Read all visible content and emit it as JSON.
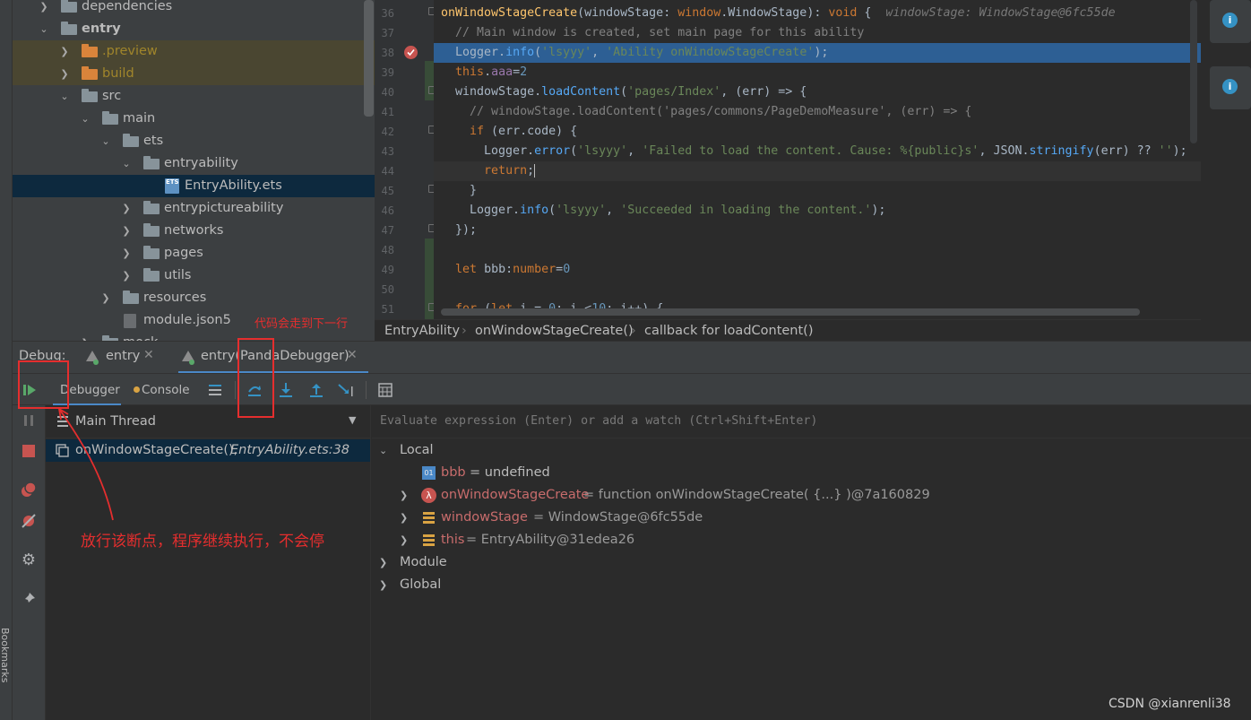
{
  "project_tree": {
    "items": [
      {
        "label": "dependencies"
      },
      {
        "label": "entry"
      },
      {
        "label": ".preview"
      },
      {
        "label": "build"
      },
      {
        "label": "src"
      },
      {
        "label": "main"
      },
      {
        "label": "ets"
      },
      {
        "label": "entryability"
      },
      {
        "label": "EntryAbility.ets",
        "icon_text": "ETS"
      },
      {
        "label": "entrypictureability"
      },
      {
        "label": "networks"
      },
      {
        "label": "pages"
      },
      {
        "label": "utils"
      },
      {
        "label": "resources"
      },
      {
        "label": "module.json5"
      },
      {
        "label": "mock"
      }
    ]
  },
  "editor": {
    "line_numbers": [
      "36",
      "37",
      "38",
      "39",
      "40",
      "41",
      "42",
      "43",
      "44",
      "45",
      "46",
      "47",
      "48",
      "49",
      "50",
      "51"
    ],
    "inline_hint": "windowStage: WindowStage@6fc55de",
    "breadcrumbs": [
      "EntryAbility",
      "onWindowStageCreate()",
      "callback for loadContent()"
    ]
  },
  "debug": {
    "label": "Debug:",
    "tabs": [
      {
        "label": "entry"
      },
      {
        "label": "entry(PandaDebugger)"
      }
    ],
    "toolbar": {
      "debugger_tab": "Debugger",
      "console_tab": "Console"
    },
    "thread": "Main Thread",
    "frame": {
      "method": "onWindowStageCreate(),",
      "location": "EntryAbility.ets:38"
    },
    "evaluate_placeholder": "Evaluate expression (Enter) or add a watch (Ctrl+Shift+Enter)",
    "variables": {
      "local_label": "Local",
      "items": [
        {
          "name": "bbb",
          "value": "= undefined",
          "icon": "01"
        },
        {
          "name": "onWindowStageCreate",
          "value": "= function onWindowStageCreate( {...} )@7a160829",
          "icon": "λ"
        },
        {
          "name": "windowStage",
          "value": "= WindowStage@6fc55de"
        },
        {
          "name": "this",
          "value": "= EntryAbility@31edea26"
        }
      ],
      "module_label": "Module",
      "global_label": "Global"
    }
  },
  "annotations": {
    "next_line": "代码会走到下一行",
    "resume": "放行该断点，程序继续执行，不会停"
  },
  "side_labels": {
    "bookmarks": "Bookmarks"
  },
  "watermark": "CSDN @xianrenli38",
  "colors": {
    "breakpoint_line": "#2d5f94",
    "annotation_red": "#e52e2e"
  }
}
